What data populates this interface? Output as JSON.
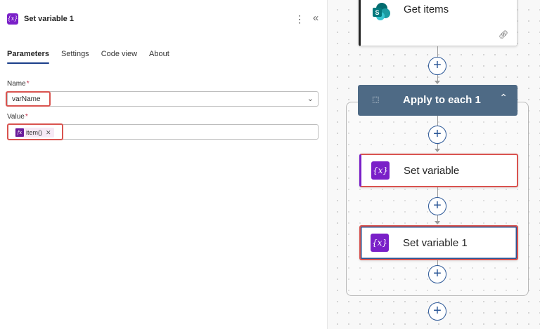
{
  "panel": {
    "title": "Set variable 1",
    "icon": "variable-icon",
    "more_glyph": "⋮",
    "collapse_glyph": "«",
    "tabs": [
      {
        "label": "Parameters",
        "active": true
      },
      {
        "label": "Settings",
        "active": false
      },
      {
        "label": "Code view",
        "active": false
      },
      {
        "label": "About",
        "active": false
      }
    ],
    "name_field": {
      "label": "Name",
      "required_mark": "*",
      "value": "varName"
    },
    "value_field": {
      "label": "Value",
      "required_mark": "*",
      "token_text": "item()",
      "token_icon": "fx"
    }
  },
  "canvas": {
    "get_items": {
      "title": "Get items",
      "icon": "sharepoint-icon",
      "link_icon": "link-icon"
    },
    "loop": {
      "title": "Apply to each 1",
      "icon": "loop-icon"
    },
    "actions": [
      {
        "title": "Set variable",
        "icon": "{x}"
      },
      {
        "title": "Set variable 1",
        "icon": "{x}"
      }
    ],
    "plus_glyph": "+"
  },
  "colors": {
    "accent_purple": "#7a20c8",
    "loop_header": "#4e6a85",
    "highlight_red": "#d9534f",
    "plus_blue": "#2b5797"
  }
}
